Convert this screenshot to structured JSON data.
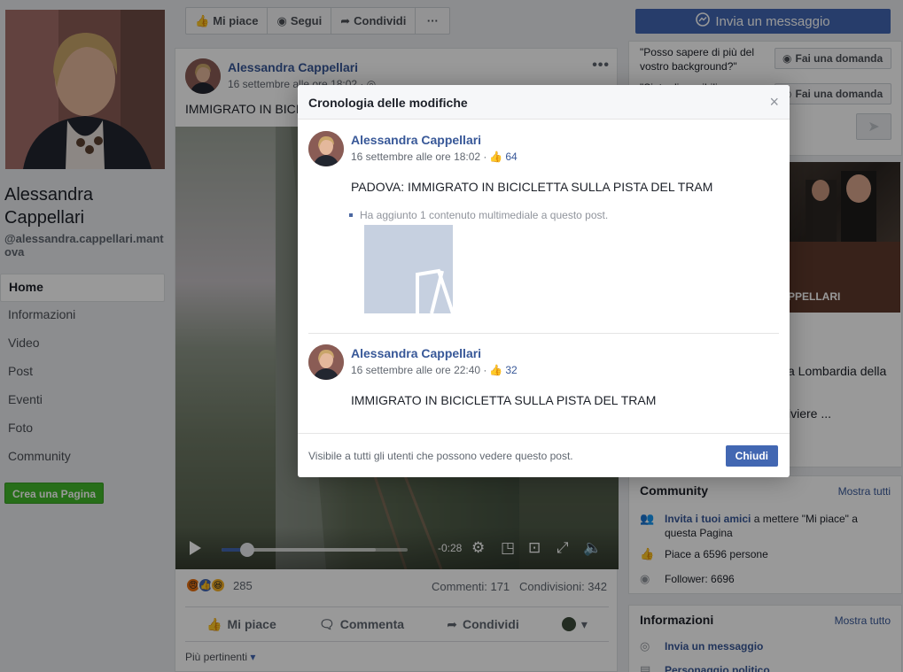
{
  "page": {
    "name": "Alessandra Cappellari",
    "handle": "@alessandra.cappellari.mantova",
    "create_page": "Crea una Pagina"
  },
  "nav": [
    "Home",
    "Informazioni",
    "Video",
    "Post",
    "Eventi",
    "Foto",
    "Community"
  ],
  "action_bar": {
    "like": "Mi piace",
    "follow": "Segui",
    "share": "Condividi",
    "more": "···"
  },
  "send_message": "Invia un messaggio",
  "post": {
    "author": "Alessandra Cappellari",
    "date": "16 settembre alle ore 18:02 · ",
    "text": "IMMIGRATO IN BICI",
    "video": {
      "time": "-0:28",
      "progress": 0.14,
      "buffered": 0.83
    },
    "reactions_count": "285",
    "stats": "Commenti: 171   Condivisioni: 342",
    "actions": {
      "like": "Mi piace",
      "comment": "Commenta",
      "share": "Condividi"
    },
    "relevance": "Più pertinenti"
  },
  "right": {
    "ask1": "\"Posso sapere di più del vostro background?\"",
    "ask2": "\"Siete disponibili per",
    "ask_btn": "Fai una domanda",
    "banner_text": "PPELLARI",
    "frag1": "a Lombardia della",
    "frag2": "iviere ...",
    "community": {
      "title": "Community",
      "link": "Mostra tutti",
      "invite_link": "Invita i tuoi amici",
      "invite_rest": " a mettere \"Mi piace\" a questa Pagina",
      "likes": "Piace a 6596 persone",
      "followers": "Follower: 6696"
    },
    "info": {
      "title": "Informazioni",
      "link": "Mostra tutto",
      "message": "Invia un messaggio",
      "category": "Personaggio politico"
    }
  },
  "modal": {
    "title": "Cronologia delle modifiche",
    "close_x": "×",
    "revisions": [
      {
        "author": "Alessandra Cappellari",
        "date": "16 settembre alle ore 18:02 · ",
        "likes": "64",
        "text": "PADOVA: IMMIGRATO IN BICICLETTA SULLA PISTA DEL TRAM",
        "change": "Ha aggiunto 1 contenuto multimediale a questo post."
      },
      {
        "author": "Alessandra Cappellari",
        "date": "16 settembre alle ore 22:40 · ",
        "likes": "32",
        "text": "IMMIGRATO IN BICICLETTA SULLA PISTA DEL TRAM"
      }
    ],
    "footer_note": "Visibile a tutti gli utenti che possono vedere questo post.",
    "close_button": "Chiudi"
  },
  "colors": {
    "brand": "#4267b2",
    "link": "#385898",
    "green": "#42b72a"
  }
}
